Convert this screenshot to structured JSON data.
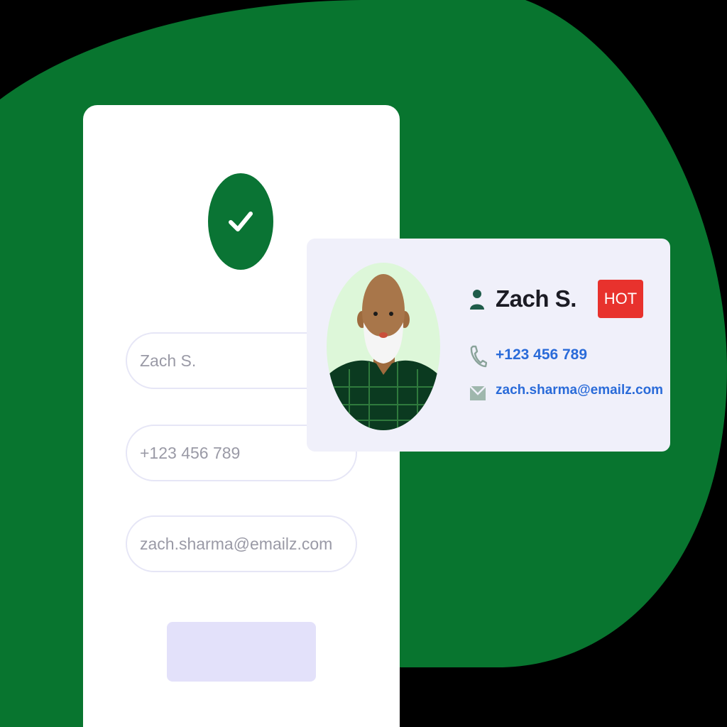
{
  "colors": {
    "background": "#000000",
    "blob": "#08752f",
    "check": "#0a7434",
    "accent_text": "#2a6bd9",
    "badge": "#e8322d",
    "button": "#e3e1fa"
  },
  "form": {
    "name_placeholder": "Zach S.",
    "phone_placeholder": "+123 456 789",
    "email_placeholder": "zach.sharma@emailz.com",
    "submit_label": ""
  },
  "contact": {
    "name": "Zach S.",
    "badge": "HOT",
    "phone": "+123 456 789",
    "email": "zach.sharma@emailz.com"
  },
  "icons": {
    "check": "check-icon",
    "person": "person-icon",
    "phone": "phone-icon",
    "mail": "mail-icon"
  }
}
